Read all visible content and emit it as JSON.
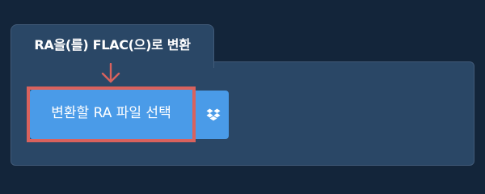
{
  "card": {
    "title": "RA을(를) FLAC(으)로 변환"
  },
  "actions": {
    "select_file_label": "변환할 RA 파일 선택",
    "dropbox_icon": "dropbox-icon"
  },
  "colors": {
    "page_background": "#13253a",
    "card_background": "#2a4766",
    "button": "#4a9be8",
    "highlight": "#d9625d"
  }
}
